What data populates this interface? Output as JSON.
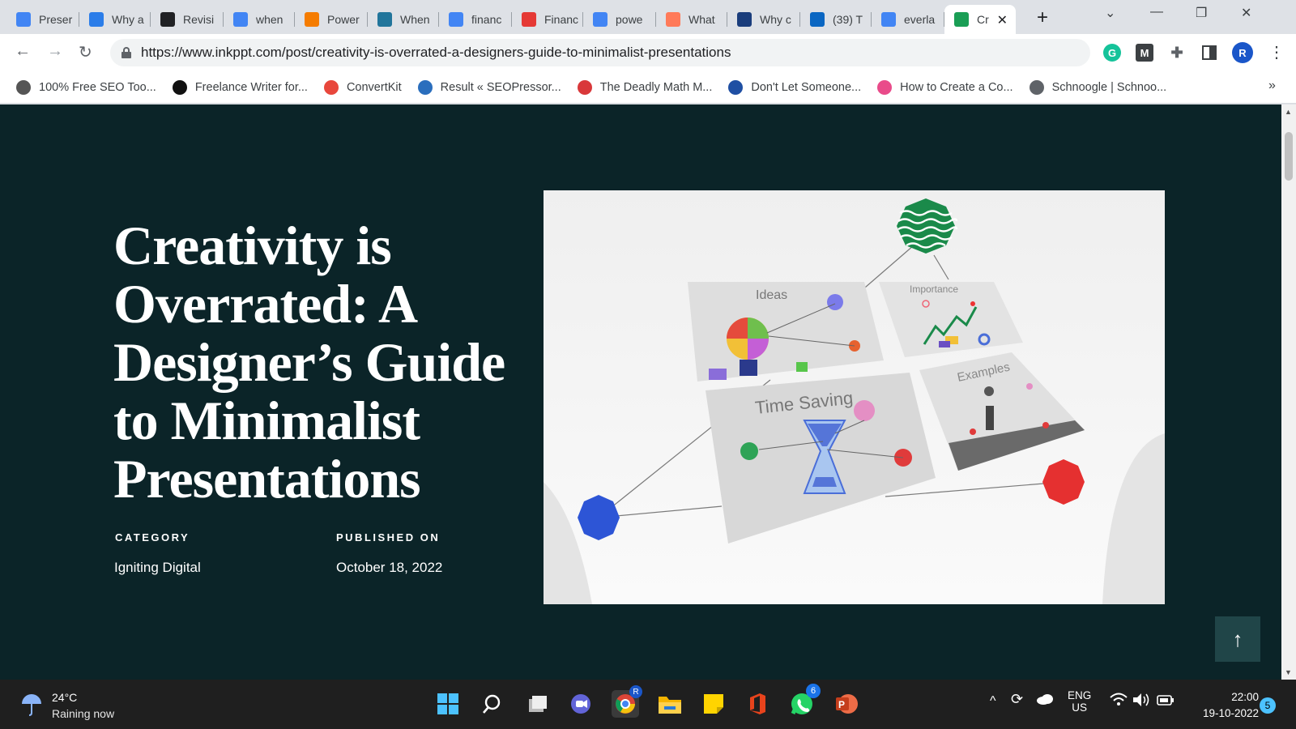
{
  "browser": {
    "tabs": [
      {
        "title": "Preser",
        "icon": "docs-icon",
        "color": "#4285f4"
      },
      {
        "title": "Why a",
        "icon": "hand-icon",
        "color": "#2b7de9"
      },
      {
        "title": "Revisi",
        "icon": "medium-icon",
        "color": "#202124"
      },
      {
        "title": "when",
        "icon": "google-icon",
        "color": "#4285f4"
      },
      {
        "title": "Power",
        "icon": "orange-circle-icon",
        "color": "#f57c00"
      },
      {
        "title": "When",
        "icon": "wordpress-icon",
        "color": "#21759b"
      },
      {
        "title": "financ",
        "icon": "google-icon",
        "color": "#4285f4"
      },
      {
        "title": "Financ",
        "icon": "24-icon",
        "color": "#e53935"
      },
      {
        "title": "powe",
        "icon": "google-icon",
        "color": "#4285f4"
      },
      {
        "title": "What",
        "icon": "hubspot-icon",
        "color": "#ff7a59"
      },
      {
        "title": "Why c",
        "icon": "puzzle-icon",
        "color": "#1a3d7c"
      },
      {
        "title": "(39) T",
        "icon": "linkedin-icon",
        "color": "#0a66c2"
      },
      {
        "title": "everla",
        "icon": "google-icon",
        "color": "#4285f4"
      },
      {
        "title": "Cr",
        "icon": "inkppt-icon",
        "color": "#1a9e55",
        "active": true
      }
    ],
    "url": "https://www.inkppt.com/post/creativity-is-overrated-a-designers-guide-to-minimalist-presentations",
    "profile_initial": "R",
    "bookmarks": [
      {
        "label": "100% Free SEO Too...",
        "icon": "sst-icon",
        "color": "#555555"
      },
      {
        "label": "Freelance Writer for...",
        "icon": "k-icon",
        "color": "#111111"
      },
      {
        "label": "ConvertKit",
        "icon": "convertkit-icon",
        "color": "#e8473c"
      },
      {
        "label": "Result « SEOPressor...",
        "icon": "seopressor-icon",
        "color": "#2a6ebd"
      },
      {
        "label": "The Deadly Math M...",
        "icon": "money-icon",
        "color": "#d9383a"
      },
      {
        "label": "Don't Let Someone...",
        "icon": "a-icon",
        "color": "#1f4fa3"
      },
      {
        "label": "How to Create a Co...",
        "icon": "m-icon",
        "color": "#e94b8a"
      },
      {
        "label": "Schnoogle | Schnoo...",
        "icon": "globe-icon",
        "color": "#5f6368"
      }
    ]
  },
  "article": {
    "title": "Creativity is Overrated: A Designer’s Guide to Minimalist Presentations",
    "category_label": "CATEGORY",
    "category_value": "Igniting Digital",
    "published_label": "PUBLISHED ON",
    "published_value": "October 18, 2022",
    "hero_labels": {
      "ideas": "Ideas",
      "importance": "Importance",
      "time_saving": "Time Saving",
      "examples": "Examples"
    }
  },
  "taskbar": {
    "temperature": "24°C",
    "weather": "Raining now",
    "language": "ENG",
    "region": "US",
    "time": "22:00",
    "date": "19-10-2022",
    "notifications": "5",
    "whatsapp_badge": "6",
    "chrome_badge": "R"
  }
}
